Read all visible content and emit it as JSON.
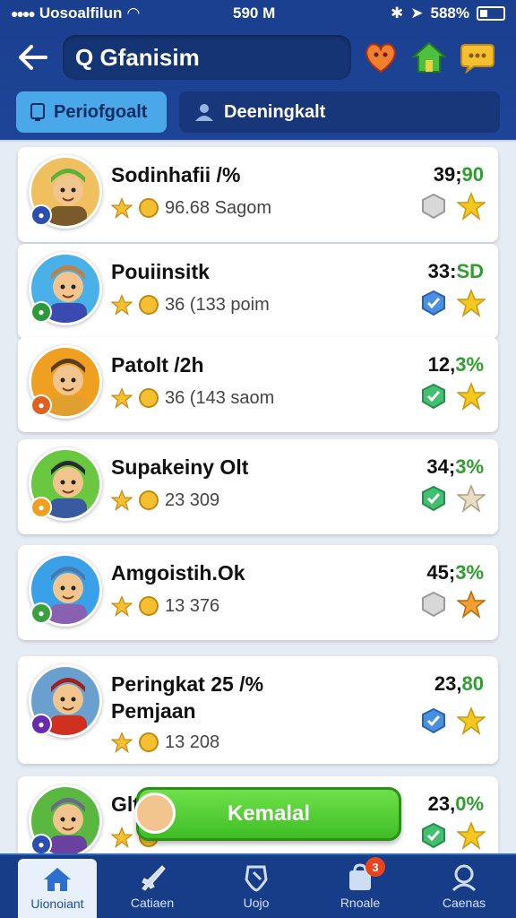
{
  "status": {
    "carrier": "Uosoalfilun",
    "time": "590 M",
    "battery": "588%"
  },
  "header": {
    "search_text": "Q Gfanisim",
    "back_icon": "arrow-left-icon"
  },
  "tabs": [
    {
      "label": "Periofgoalt",
      "active": true
    },
    {
      "label": "Deeningkalt",
      "active": false
    }
  ],
  "players": [
    {
      "name": "Sodinhafii /%",
      "sub": "96.68 Sagom",
      "score_a": "39;",
      "score_b": "90",
      "avatar_color": "#f0c060",
      "shirt": "#7a5a2a",
      "hat": "#5ab040"
    },
    {
      "name": "Pouiinsitk",
      "sub": "36 (133 poim",
      "score_a": "33:",
      "score_b": "SD",
      "avatar_color": "#4ab0e8",
      "shirt": "#3a4ab0",
      "hat": "#c08040"
    },
    {
      "name": "Patolt /2h",
      "sub": "36 (143 saom",
      "score_a": "12,",
      "score_b": "3%",
      "avatar_color": "#f0a020",
      "shirt": "#e0a030",
      "hat": "#5a3a20"
    },
    {
      "name": "Supakeiny Olt",
      "sub": "23 309",
      "score_a": "34;",
      "score_b": "3%",
      "avatar_color": "#6ac840",
      "shirt": "#3a5aa0",
      "hat": "#2a2a2a"
    },
    {
      "name": "Amgoistih.Ok",
      "sub": "13  376",
      "score_a": "45;",
      "score_b": "3%",
      "avatar_color": "#3aa0e8",
      "shirt": "#8a60b0",
      "hat": "#4a78b0"
    },
    {
      "name": "Peringkat 25 /%",
      "name2": "Pemjaan",
      "sub": "13  208",
      "score_a": "23,",
      "score_b": "80",
      "avatar_color": "#6aa0d0",
      "shirt": "#d03020",
      "hat": "#a02020"
    },
    {
      "name": "Glt",
      "sub": "",
      "score_a": "23,",
      "score_b": "0%",
      "avatar_color": "#5ab840",
      "shirt": "#6a40a0",
      "hat": "#6a6a8a"
    }
  ],
  "cta": {
    "label": "Kemalal"
  },
  "nav": [
    {
      "label": "Uionoiant",
      "icon": "home-icon",
      "active": true
    },
    {
      "label": "Catiaen",
      "icon": "sword-icon",
      "active": false
    },
    {
      "label": "Uojo",
      "icon": "shield-icon",
      "active": false
    },
    {
      "label": "Rnoale",
      "icon": "bag-icon",
      "active": false,
      "badge": "3"
    },
    {
      "label": "Caenas",
      "icon": "profile-icon",
      "active": false
    }
  ]
}
